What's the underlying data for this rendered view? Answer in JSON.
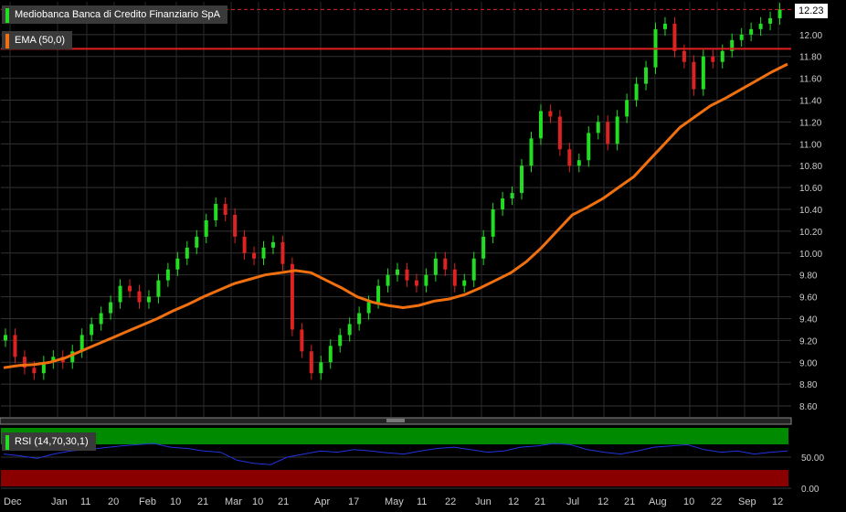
{
  "chart_data": {
    "type": "candlestick",
    "title": "Mediobanca Banca di Credito Finanziario SpA",
    "last_price": "12.23",
    "resistance_level": 11.87,
    "ylim": [
      8.5,
      12.3
    ],
    "yticks": [
      "8.60",
      "8.80",
      "9.00",
      "9.20",
      "9.40",
      "9.60",
      "9.80",
      "10.00",
      "10.20",
      "10.40",
      "10.60",
      "10.80",
      "11.00",
      "11.20",
      "11.40",
      "11.60",
      "11.80",
      "12.00",
      "12.23"
    ],
    "xticks": [
      "Dec",
      "Jan",
      "11",
      "20",
      "Feb",
      "10",
      "21",
      "Mar",
      "10",
      "21",
      "Apr",
      "17",
      "May",
      "11",
      "22",
      "Jun",
      "12",
      "21",
      "Jul",
      "12",
      "21",
      "Aug",
      "10",
      "22",
      "Sep",
      "12"
    ],
    "price_series": [
      9.25,
      9.05,
      8.95,
      8.9,
      9.0,
      9.05,
      9.0,
      9.1,
      9.25,
      9.35,
      9.45,
      9.55,
      9.7,
      9.65,
      9.55,
      9.6,
      9.75,
      9.85,
      9.95,
      10.05,
      10.15,
      10.3,
      10.45,
      10.35,
      10.15,
      10.0,
      9.95,
      10.05,
      10.1,
      9.9,
      9.3,
      9.1,
      8.9,
      9.0,
      9.15,
      9.25,
      9.35,
      9.45,
      9.55,
      9.7,
      9.8,
      9.85,
      9.75,
      9.7,
      9.8,
      9.95,
      9.85,
      9.7,
      9.75,
      9.95,
      10.15,
      10.4,
      10.5,
      10.55,
      10.8,
      11.05,
      11.3,
      11.25,
      10.95,
      10.8,
      10.85,
      11.1,
      11.2,
      11.0,
      11.25,
      11.4,
      11.55,
      11.7,
      12.05,
      12.1,
      11.85,
      11.75,
      11.5,
      11.8,
      11.75,
      11.85,
      11.95,
      12.0,
      12.05,
      12.1,
      12.15,
      12.23
    ],
    "ema": {
      "name": "EMA (50,0)",
      "color": "#f07010",
      "values": [
        8.95,
        8.97,
        8.98,
        9.0,
        9.04,
        9.1,
        9.16,
        9.22,
        9.28,
        9.34,
        9.4,
        9.47,
        9.53,
        9.6,
        9.66,
        9.72,
        9.76,
        9.8,
        9.82,
        9.84,
        9.82,
        9.75,
        9.68,
        9.6,
        9.55,
        9.52,
        9.5,
        9.52,
        9.56,
        9.58,
        9.62,
        9.68,
        9.75,
        9.82,
        9.92,
        10.05,
        10.2,
        10.35,
        10.42,
        10.5,
        10.6,
        10.7,
        10.85,
        11.0,
        11.15,
        11.25,
        11.35,
        11.42,
        11.5,
        11.58,
        11.66,
        11.73
      ]
    },
    "rsi": {
      "name": "RSI (14,70,30,1)",
      "upper": 70,
      "lower": 30,
      "ticks": [
        "50.00",
        "0.00"
      ],
      "values": [
        55,
        52,
        48,
        55,
        60,
        62,
        65,
        68,
        70,
        72,
        66,
        64,
        60,
        58,
        45,
        40,
        38,
        50,
        55,
        60,
        58,
        62,
        60,
        57,
        55,
        60,
        64,
        66,
        62,
        58,
        60,
        66,
        68,
        72,
        70,
        62,
        58,
        55,
        60,
        66,
        68,
        70,
        62,
        58,
        60,
        55,
        58,
        60
      ]
    },
    "series_colors": {
      "up": "#22dd22",
      "down": "#dd2222",
      "rsi_line": "#2233dd",
      "rsi_high_band": "#008a00",
      "rsi_low_band": "#8a0000"
    }
  }
}
